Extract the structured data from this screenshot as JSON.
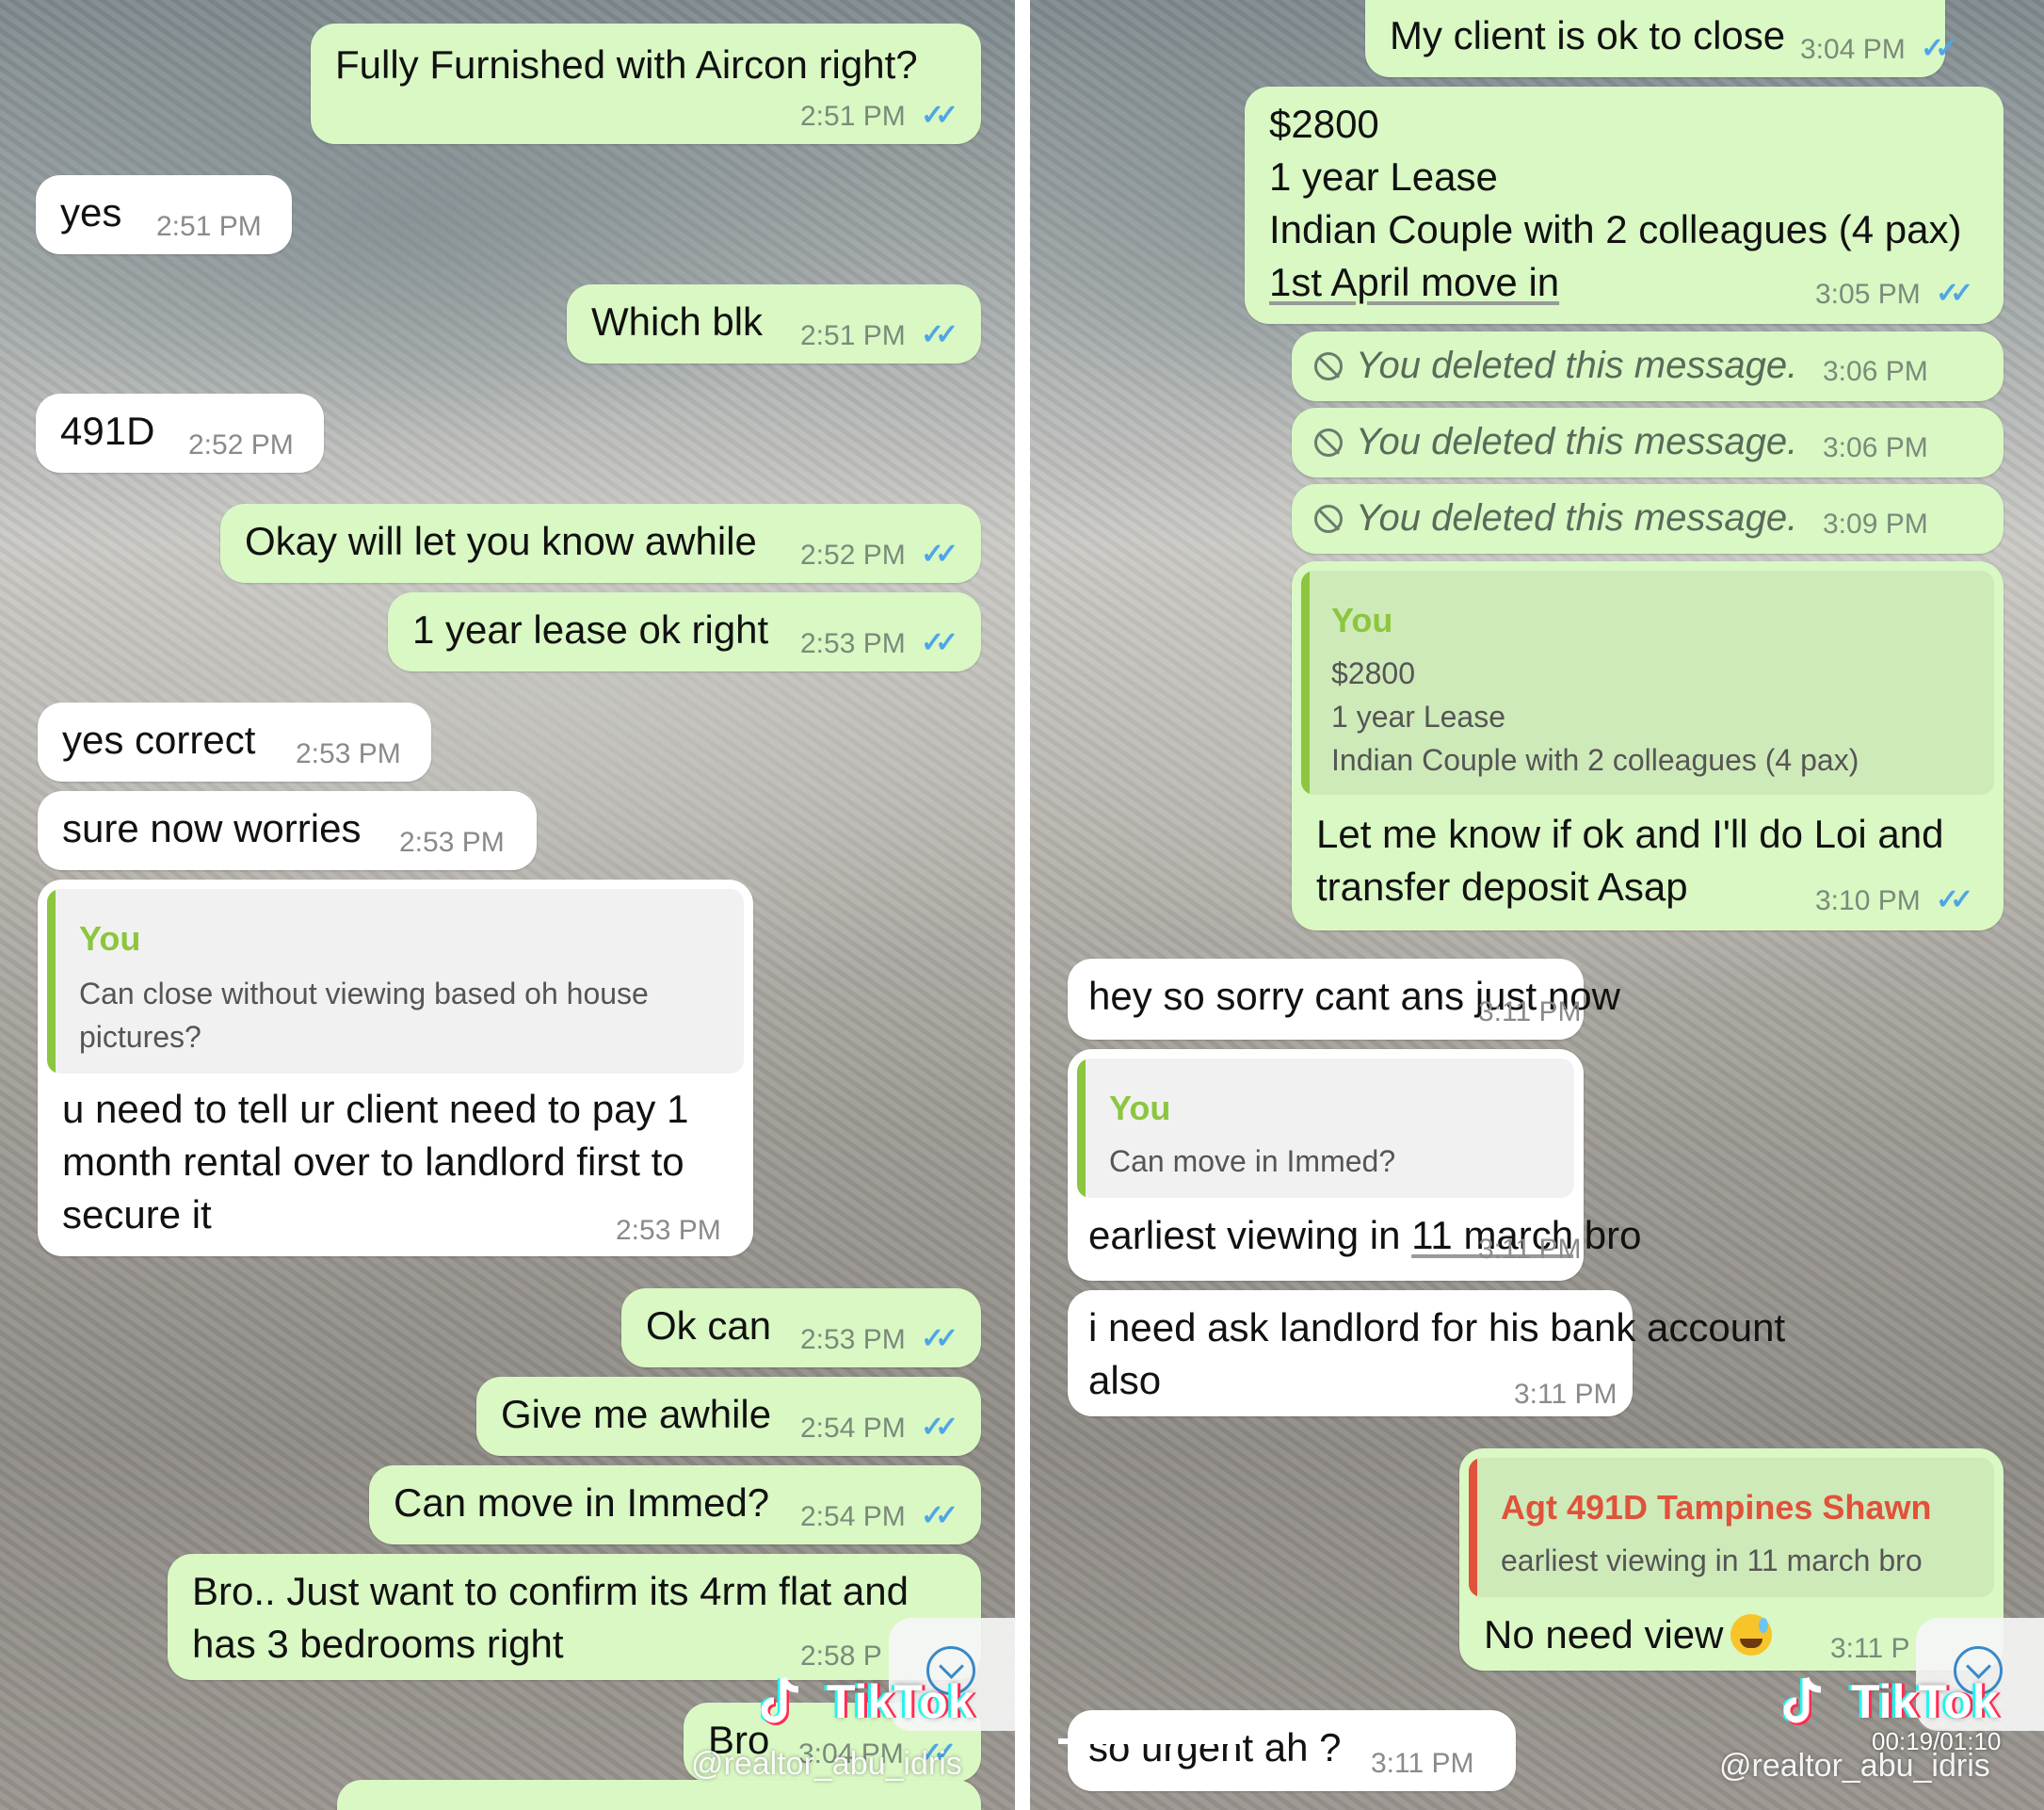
{
  "left": {
    "messages": [
      {
        "text": "Fully Furnished with Aircon right?",
        "time": "2:51 PM"
      },
      {
        "text": "yes",
        "time": "2:51 PM"
      },
      {
        "text": "Which blk",
        "time": "2:51 PM"
      },
      {
        "text": "491D",
        "time": "2:52 PM"
      },
      {
        "text": "Okay will let you know awhile",
        "time": "2:52 PM"
      },
      {
        "text": "1 year lease ok right",
        "time": "2:53 PM"
      },
      {
        "text": "yes correct",
        "time": "2:53 PM"
      },
      {
        "text": "sure now worries",
        "time": "2:53 PM"
      },
      {
        "quote_name": "You",
        "quote_lines": [
          "Can close without viewing based oh house",
          "pictures?"
        ],
        "lines": [
          "u need to tell ur client need to pay 1",
          "month rental over to landlord first to",
          "secure it"
        ],
        "time": "2:53 PM"
      },
      {
        "text": "Ok can",
        "time": "2:53 PM"
      },
      {
        "text": "Give me awhile",
        "time": "2:54 PM"
      },
      {
        "text": "Can move in Immed?",
        "time": "2:54 PM"
      },
      {
        "lines": [
          "Bro.. Just want to confirm its 4rm flat and",
          "has 3 bedrooms right"
        ],
        "time": "2:58 P"
      },
      {
        "text": "Bro",
        "time": "3:04 PM"
      }
    ],
    "overlay": {
      "brand": "TikTok",
      "handle": "@realtor_abu_idris"
    }
  },
  "right": {
    "messages": [
      {
        "text": "My client is ok to close",
        "time": "3:04 PM"
      },
      {
        "lines": [
          "$2800",
          "1 year Lease",
          "Indian Couple with 2 colleagues (4 pax)",
          "1st April move in"
        ],
        "time": "3:05 PM"
      },
      {
        "deleted": "You deleted this message.",
        "time": "3:06 PM"
      },
      {
        "deleted": "You deleted this message.",
        "time": "3:06 PM"
      },
      {
        "deleted": "You deleted this message.",
        "time": "3:09 PM"
      },
      {
        "quote_name": "You",
        "quote_lines": [
          "$2800",
          "1 year Lease",
          "Indian Couple with 2 colleagues (4 pax)"
        ],
        "lines": [
          "Let me know if ok and I'll do Loi and",
          "transfer deposit Asap"
        ],
        "time": "3:10 PM"
      },
      {
        "text": "hey so sorry cant ans just now",
        "time": "3:11 PM"
      },
      {
        "quote_name": "You",
        "quote_lines": [
          "Can move in Immed?"
        ],
        "text_a": "earliest viewing in ",
        "text_b": "11 march",
        "text_c": " bro",
        "time": "3:11 PM"
      },
      {
        "lines": [
          "i need ask landlord for his bank account",
          "also"
        ],
        "time": "3:11 PM"
      },
      {
        "quote_name": "Agt 491D Tampines Shawn",
        "quote_lines": [
          "earliest viewing in 11 march bro"
        ],
        "text": "No need view",
        "time": "3:11 P"
      },
      {
        "text": "so urgent ah ?",
        "time": "3:11 PM"
      }
    ],
    "overlay": {
      "brand": "TikTok",
      "handle": "@realtor_abu_idris",
      "timer": "00:19/01:10"
    }
  },
  "colors": {
    "outgoing": "#d9f8c4",
    "incoming": "#ffffff",
    "tick": "#4fa5e6",
    "quote_you": "#8cc63f",
    "quote_agent": "#e0523a"
  },
  "icons": [
    "double-check-icon",
    "deleted-ban-icon",
    "scroll-down-icon",
    "tiktok-logo-icon",
    "grinning-sweat-emoji"
  ]
}
